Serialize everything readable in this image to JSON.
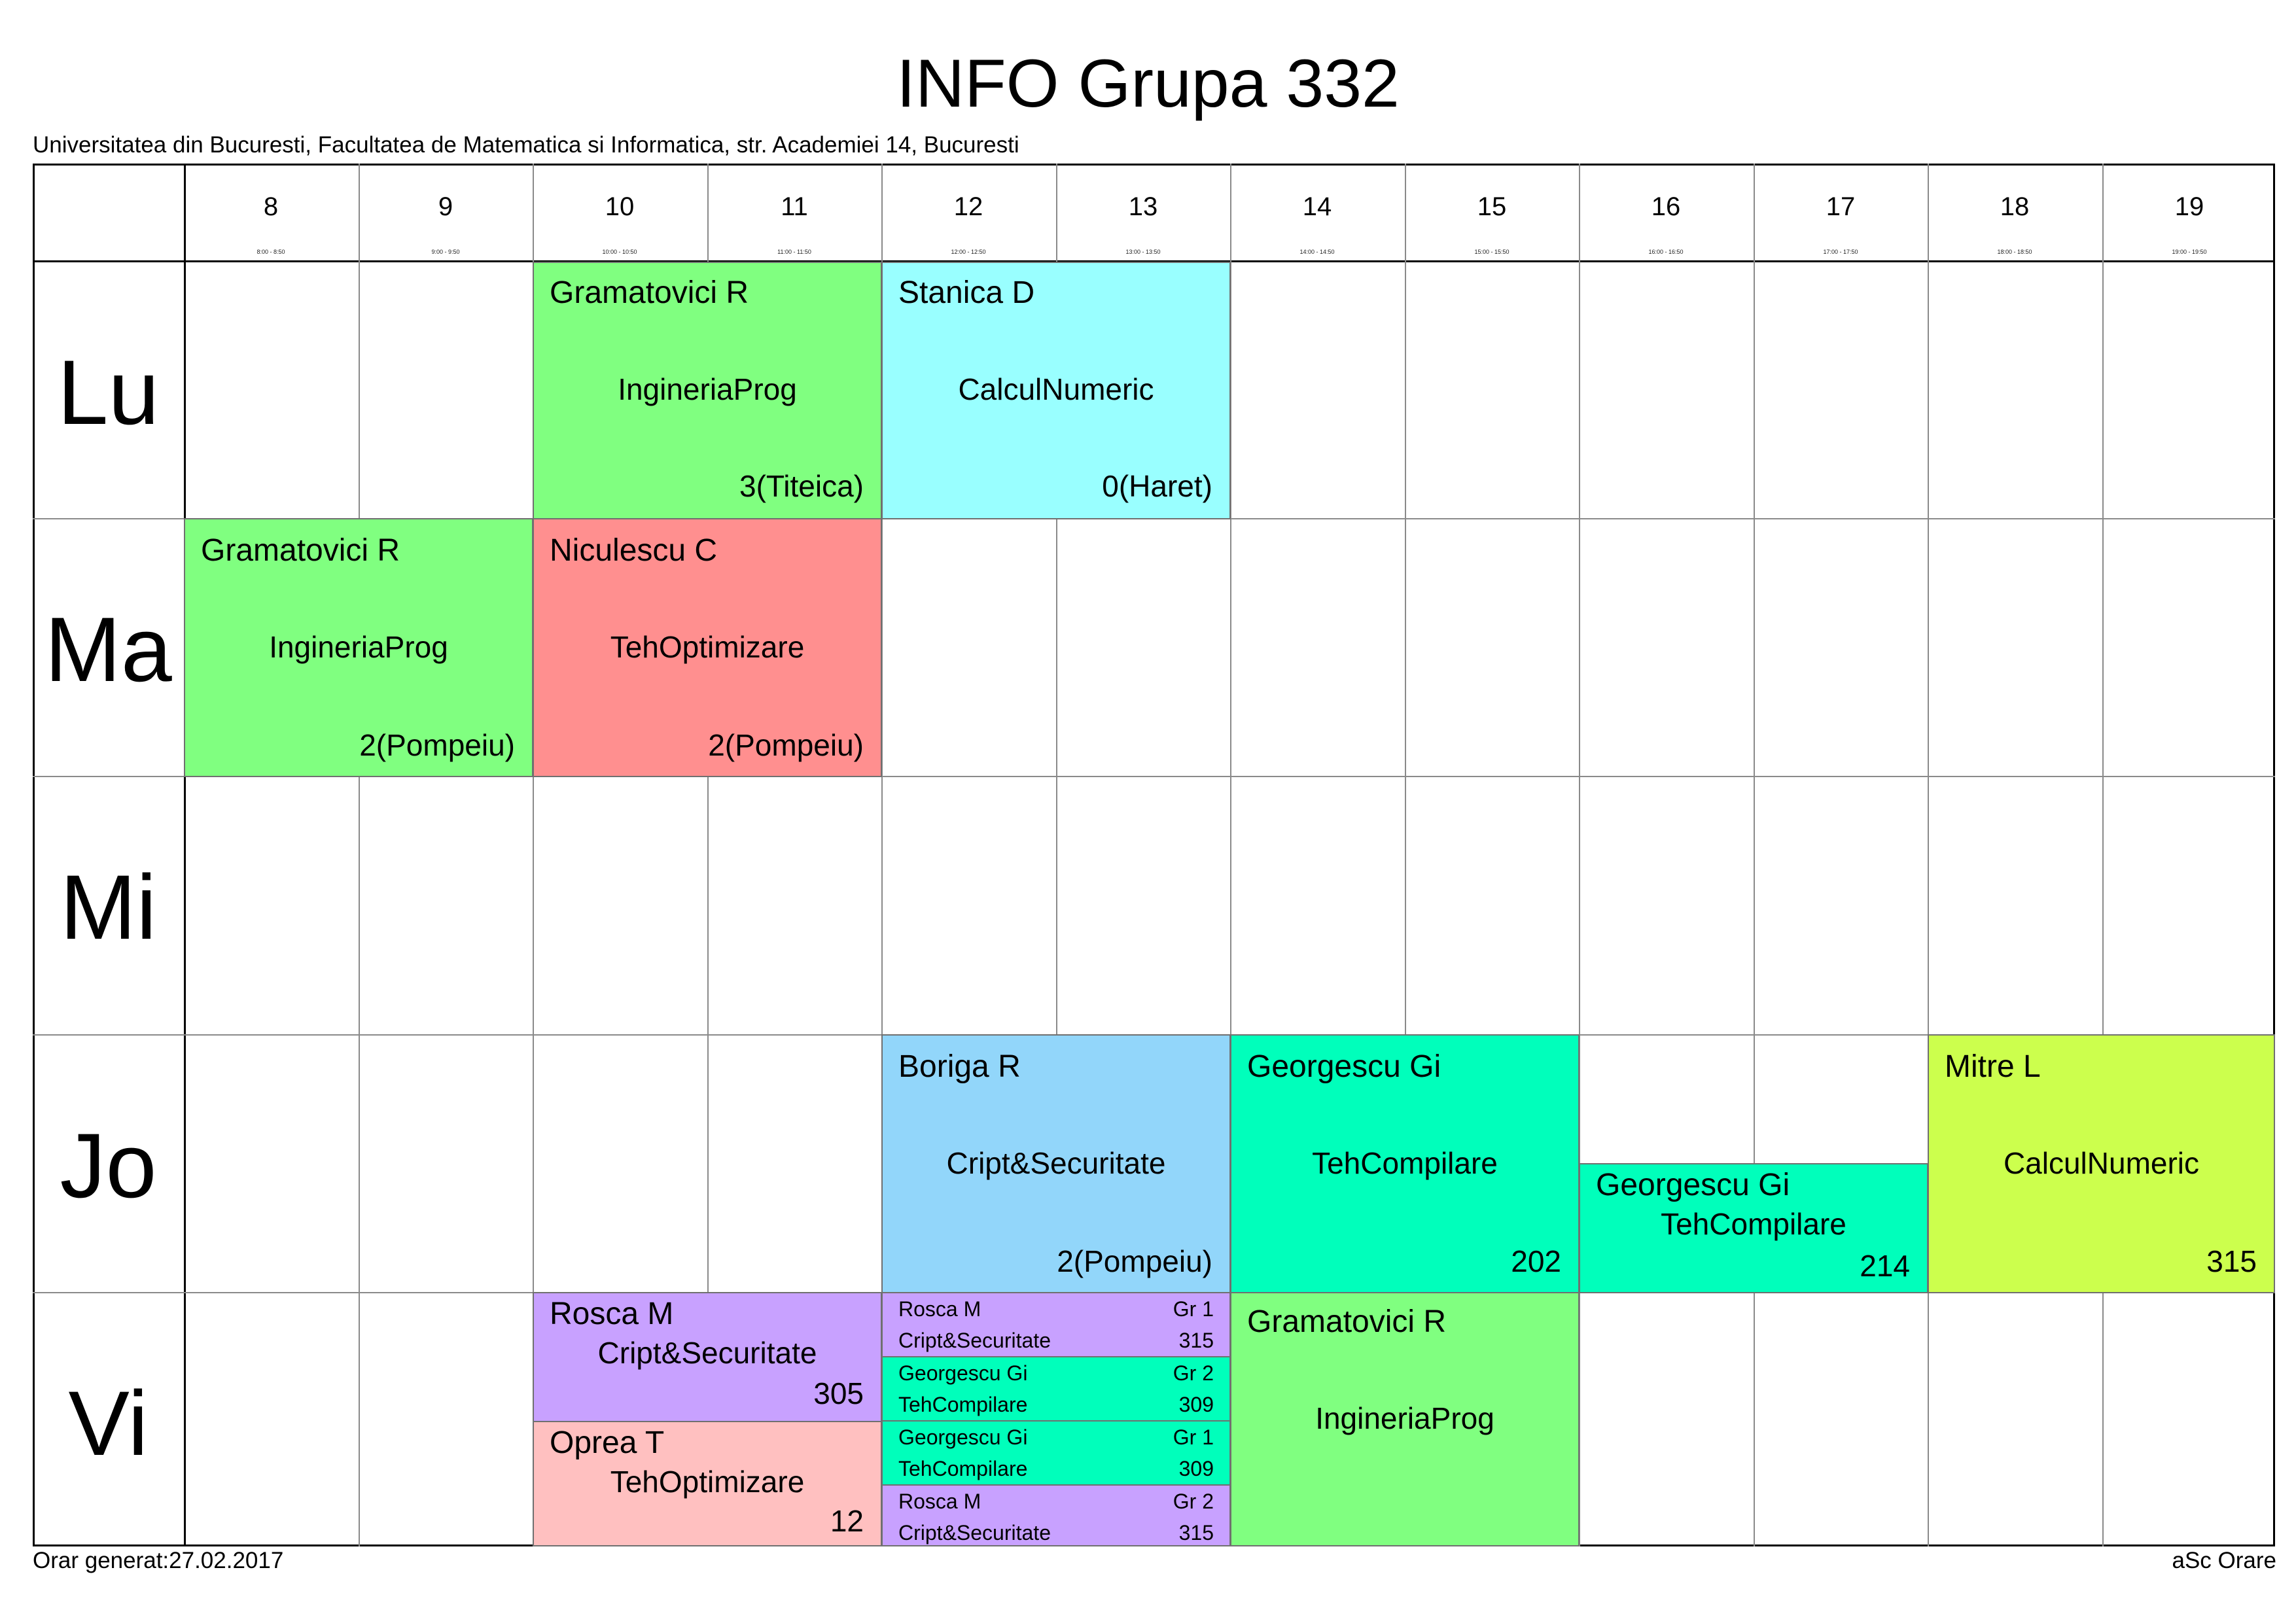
{
  "title": "INFO Grupa 332",
  "subtitle": "Universitatea din Bucuresti, Facultatea de Matematica si Informatica, str. Academiei 14, Bucuresti",
  "footer_left": "Orar generat:27.02.2017",
  "footer_right": "aSc Orare",
  "hours": [
    "8",
    "9",
    "10",
    "11",
    "12",
    "13",
    "14",
    "15",
    "16",
    "17",
    "18",
    "19"
  ],
  "hour_ranges": [
    "8:00 - 8:50",
    "9:00 - 9:50",
    "10:00 - 10:50",
    "11:00 - 11:50",
    "12:00 - 12:50",
    "13:00 - 13:50",
    "14:00 - 14:50",
    "15:00 - 15:50",
    "16:00 - 16:50",
    "17:00 - 17:50",
    "18:00 - 18:50",
    "19:00 - 19:50"
  ],
  "days": [
    "Lu",
    "Ma",
    "Mi",
    "Jo",
    "Vi"
  ],
  "colors": {
    "ingineria": "#80ff80",
    "calcul": "#99ffff",
    "optimizare": "#ff8f8f",
    "optimizare_light": "#ffc0c0",
    "cript_blue": "#92d6fa",
    "compilare": "#00ffbb",
    "calcul_lime": "#ccff4d",
    "cript_purple": "#c8a1ff"
  },
  "lessons": [
    {
      "teacher": "Gramatovici R",
      "subject": "IngineriaProg",
      "room": "3(Titeica)"
    },
    {
      "teacher": "Stanica D",
      "subject": "CalculNumeric",
      "room": "0(Haret)"
    },
    {
      "teacher": "Gramatovici R",
      "subject": "IngineriaProg",
      "room": "2(Pompeiu)"
    },
    {
      "teacher": "Niculescu C",
      "subject": "TehOptimizare",
      "room": "2(Pompeiu)"
    },
    {
      "teacher": "Boriga R",
      "subject": "Cript&Securitate",
      "room": "2(Pompeiu)"
    },
    {
      "teacher": "Georgescu Gi",
      "subject": "TehCompilare",
      "room": "202"
    },
    {
      "teacher": "Georgescu Gi",
      "subject": "TehCompilare",
      "room": "214"
    },
    {
      "teacher": "Mitre L",
      "subject": "CalculNumeric",
      "room": "315"
    },
    {
      "teacher": "Rosca M",
      "subject": "Cript&Securitate",
      "room": "305"
    },
    {
      "teacher": "Oprea T",
      "subject": "TehOptimizare",
      "room": "12"
    },
    {
      "teacher": "Gramatovici R",
      "subject": "IngineriaProg",
      "room": ""
    }
  ],
  "mini_lessons": [
    {
      "teacher": "Rosca M",
      "group": "Gr 1",
      "subject": "Cript&Securitate",
      "room": "315"
    },
    {
      "teacher": "Georgescu Gi",
      "group": "Gr 2",
      "subject": "TehCompilare",
      "room": "309"
    },
    {
      "teacher": "Georgescu Gi",
      "group": "Gr 1",
      "subject": "TehCompilare",
      "room": "309"
    },
    {
      "teacher": "Rosca M",
      "group": "Gr 2",
      "subject": "Cript&Securitate",
      "room": "315"
    }
  ]
}
